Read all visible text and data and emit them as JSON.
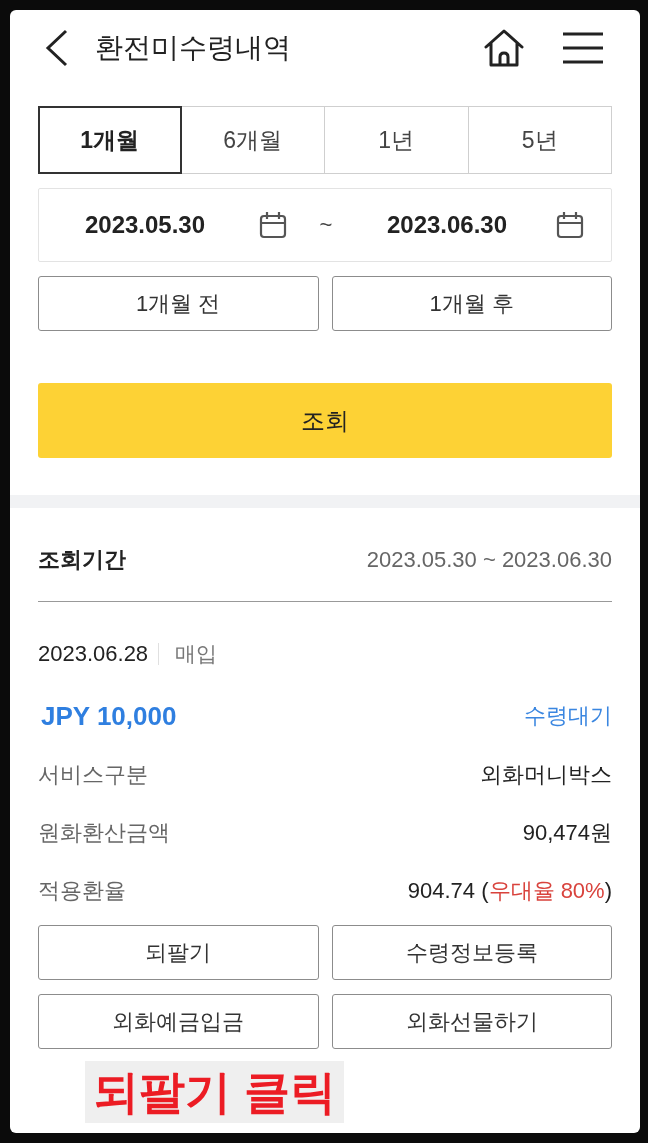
{
  "header": {
    "title": "환전미수령내역"
  },
  "period_tabs": [
    {
      "label": "1개월",
      "selected": true
    },
    {
      "label": "6개월",
      "selected": false
    },
    {
      "label": "1년",
      "selected": false
    },
    {
      "label": "5년",
      "selected": false
    }
  ],
  "date_range": {
    "start": "2023.05.30",
    "separator": "~",
    "end": "2023.06.30"
  },
  "shift_buttons": [
    "1개월 전",
    "1개월 후"
  ],
  "search_button": "조회",
  "inquiry": {
    "period_label": "조회기간",
    "period_value": "2023.05.30 ~ 2023.06.30"
  },
  "transaction": {
    "date": "2023.06.28",
    "type": "매입",
    "amount": "JPY 10,000",
    "status": "수령대기",
    "details": [
      {
        "label": "서비스구분",
        "parts": [
          {
            "text": "외화머니박스",
            "kind": "plain"
          }
        ]
      },
      {
        "label": "원화환산금액",
        "parts": [
          {
            "text": "90,474원",
            "kind": "plain"
          }
        ]
      },
      {
        "label": "적용환율",
        "parts": [
          {
            "text": "904.74 (",
            "kind": "plain"
          },
          {
            "text": "우대율 80%",
            "kind": "highlight"
          },
          {
            "text": ")",
            "kind": "plain"
          }
        ]
      }
    ]
  },
  "actions": [
    "되팔기",
    "수령정보등록",
    "외화예금입금",
    "외화선물하기"
  ],
  "annotation": {
    "text": "되팔기 클릭"
  }
}
